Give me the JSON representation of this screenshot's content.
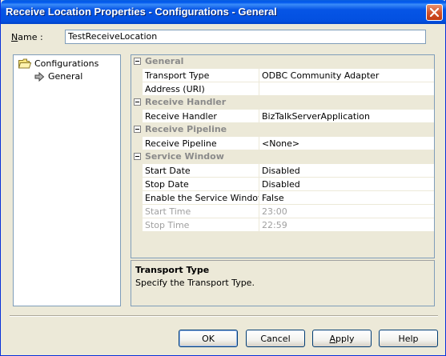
{
  "window": {
    "title": "Receive Location Properties - Configurations - General"
  },
  "name_field": {
    "label": "Name :",
    "value": "TestReceiveLocation"
  },
  "tree": {
    "root": "Configurations",
    "child": "General"
  },
  "grid": {
    "categories": [
      {
        "label": "General",
        "props": [
          {
            "name": "Transport Type",
            "value": "ODBC Community Adapter",
            "enabled": true
          },
          {
            "name": "Address (URI)",
            "value": "",
            "enabled": true
          }
        ]
      },
      {
        "label": "Receive Handler",
        "props": [
          {
            "name": "Receive Handler",
            "value": "BizTalkServerApplication",
            "enabled": true
          }
        ]
      },
      {
        "label": "Receive Pipeline",
        "props": [
          {
            "name": "Receive Pipeline",
            "value": "<None>",
            "enabled": true
          }
        ]
      },
      {
        "label": "Service Window",
        "props": [
          {
            "name": "Start Date",
            "value": "Disabled",
            "enabled": true
          },
          {
            "name": "Stop Date",
            "value": "Disabled",
            "enabled": true
          },
          {
            "name": "Enable the Service Window",
            "value": "False",
            "enabled": true
          },
          {
            "name": "Start Time",
            "value": "23:00",
            "enabled": false
          },
          {
            "name": "Stop Time",
            "value": "22:59",
            "enabled": false
          }
        ]
      }
    ]
  },
  "description": {
    "title": "Transport Type",
    "text": "Specify the Transport Type."
  },
  "buttons": {
    "ok": "OK",
    "cancel": "Cancel",
    "apply": "Apply",
    "help": "Help"
  }
}
